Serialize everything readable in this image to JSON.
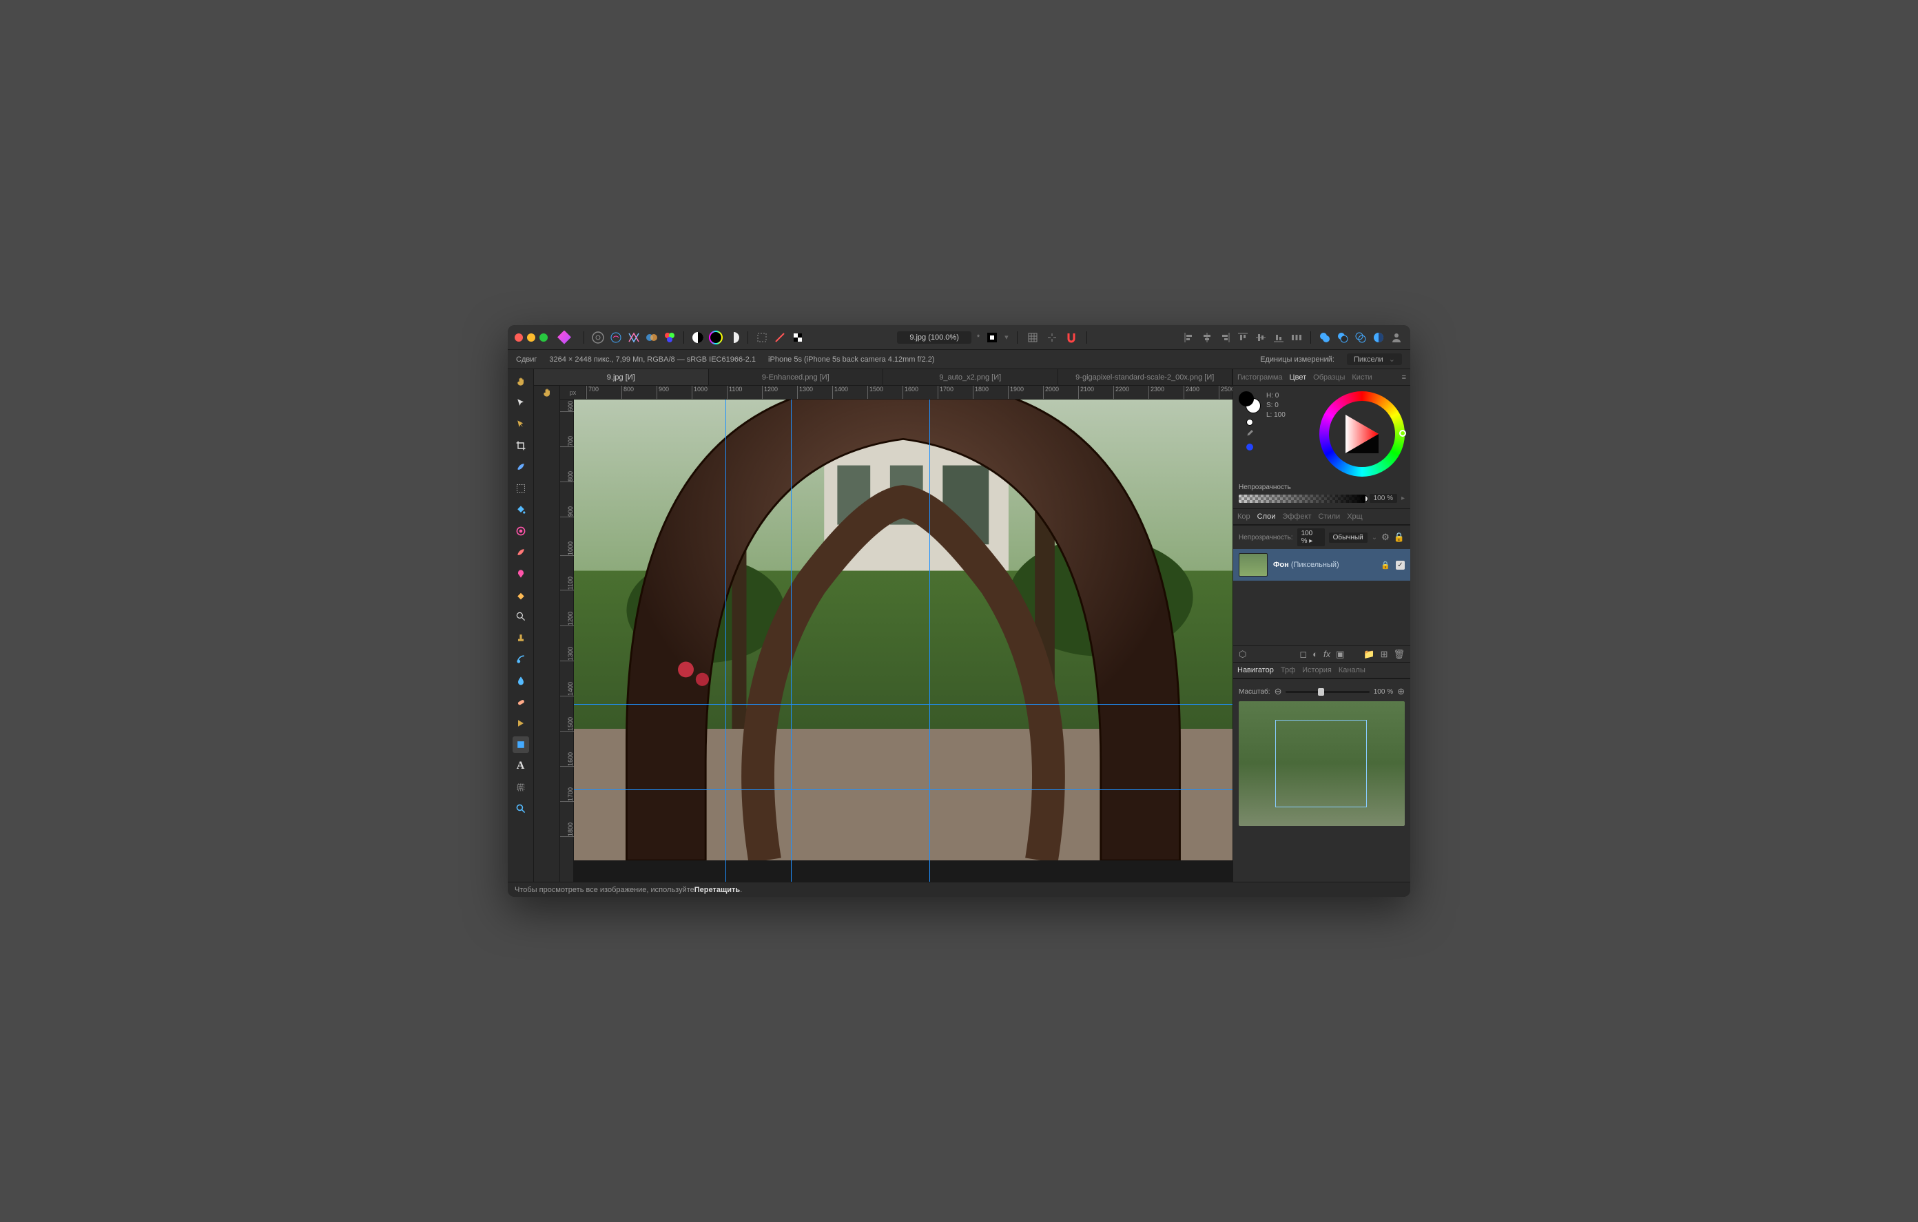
{
  "window": {
    "title": "9.jpg (100.0%)",
    "modified": "*"
  },
  "toolbar_icons": [
    "persona-photo",
    "persona-liquify",
    "persona-develop",
    "persona-tone",
    "persona-export",
    "sep",
    "gradient-map",
    "adjust-bw",
    "color-wheel-icon",
    "half-circle",
    "sep",
    "marquee-dashed",
    "diagonal-line",
    "checker",
    "sep",
    "",
    "",
    "",
    "sep",
    "align-center",
    "grid-icon",
    "snap-off",
    "magnet",
    "sep",
    "align-left-group",
    "align-center-group",
    "align-right-group",
    "align-top-group",
    "align-middle-group",
    "align-bottom-group",
    "distribute",
    "sep",
    "shape-circle",
    "shape-sub",
    "shape-int",
    "shape-half",
    "user-icon"
  ],
  "infobar": {
    "tool_name": "Сдвиг",
    "dimensions": "3264 × 2448 пикс., 7,99 Мп, RGBA/8 — sRGB IEC61966-2.1",
    "camera": "iPhone 5s (iPhone 5s back camera 4.12mm f/2.2)",
    "units_label": "Единицы измерений:",
    "units_value": "Пиксели"
  },
  "doc_tabs": [
    {
      "label": "9.jpg [И]",
      "active": true
    },
    {
      "label": "9-Enhanced.png [И]",
      "active": false
    },
    {
      "label": "9_auto_x2.png [И]",
      "active": false
    },
    {
      "label": "9-gigapixel-standard-scale-2_00x.png [И]",
      "active": false
    }
  ],
  "rulers": {
    "unit_label": "px",
    "h": [
      700,
      800,
      900,
      1000,
      1100,
      1200,
      1300,
      1400,
      1500,
      1600,
      1700,
      1800,
      1900,
      2000,
      2100,
      2200,
      2300,
      2400,
      2500
    ],
    "v": [
      600,
      700,
      800,
      900,
      1000,
      1100,
      1200,
      1300,
      1400,
      1500,
      1600,
      1700,
      1800
    ]
  },
  "guides": {
    "v": [
      23,
      33,
      54
    ],
    "h": [
      63.2,
      80.8
    ]
  },
  "right_panel": {
    "top_tabs": [
      "Гистограмма",
      "Цвет",
      "Образцы",
      "Кисти"
    ],
    "top_active": "Цвет",
    "hsl": {
      "h": "H: 0",
      "s": "S: 0",
      "l": "L: 100"
    },
    "opacity_label": "Непрозрачность",
    "opacity_value": "100 %",
    "mid_tabs": [
      "Кор",
      "Слои",
      "Эффект",
      "Стили",
      "Хрщ"
    ],
    "mid_active": "Слои",
    "layer_opacity_label": "Непрозрачность:",
    "layer_opacity_value": "100 %",
    "blend_mode": "Обычный",
    "layers": [
      {
        "name": "Фон",
        "type": "(Пиксельный)",
        "locked": true,
        "visible": true
      }
    ],
    "bottom_tabs": [
      "Навигатор",
      "Трф",
      "История",
      "Каналы"
    ],
    "bottom_active": "Навигатор",
    "zoom_label": "Масштаб:",
    "zoom_value": "100 %"
  },
  "statusbar": {
    "text": "Чтобы просмотреть все изображение, используйте ",
    "bold": "Перетащить",
    "suffix": "."
  },
  "tools": [
    "move",
    "selection",
    "hand",
    "crop",
    "brush",
    "dotted-select",
    "flood",
    "color-picker",
    "paint",
    "clone",
    "erase",
    "zoom-lens",
    "stamp",
    "heal",
    "patch",
    "blur",
    "inpaint",
    "dodge",
    "pen",
    "shape",
    "text",
    "mesh",
    "zoom"
  ]
}
